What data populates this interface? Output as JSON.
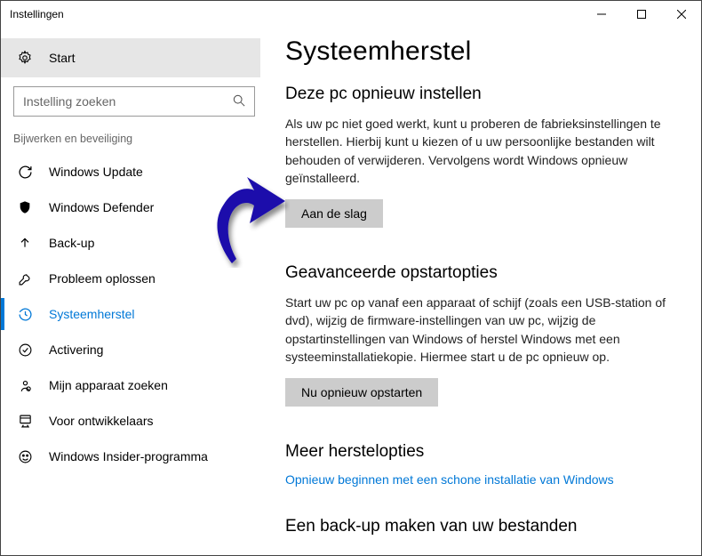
{
  "window": {
    "title": "Instellingen"
  },
  "sidebar": {
    "start_label": "Start",
    "search_placeholder": "Instelling zoeken",
    "section_label": "Bijwerken en beveiliging",
    "items": [
      {
        "label": "Windows Update",
        "icon": "sync-icon"
      },
      {
        "label": "Windows Defender",
        "icon": "shield-icon"
      },
      {
        "label": "Back-up",
        "icon": "backup-arrow-icon"
      },
      {
        "label": "Probleem oplossen",
        "icon": "wrench-icon"
      },
      {
        "label": "Systeemherstel",
        "icon": "history-icon",
        "active": true
      },
      {
        "label": "Activering",
        "icon": "check-circle-icon"
      },
      {
        "label": "Mijn apparaat zoeken",
        "icon": "find-device-icon"
      },
      {
        "label": "Voor ontwikkelaars",
        "icon": "developer-icon"
      },
      {
        "label": "Windows Insider-programma",
        "icon": "insider-icon"
      }
    ]
  },
  "main": {
    "title": "Systeemherstel",
    "reset": {
      "heading": "Deze pc opnieuw instellen",
      "text": "Als uw pc niet goed werkt, kunt u proberen de fabrieksinstellingen te herstellen. Hierbij kunt u kiezen of u uw persoonlijke bestanden wilt behouden of verwijderen. Vervolgens wordt Windows opnieuw geïnstalleerd.",
      "button": "Aan de slag"
    },
    "advanced": {
      "heading": "Geavanceerde opstartopties",
      "text": "Start uw pc op vanaf een apparaat of schijf (zoals een USB-station of dvd), wijzig de firmware-instellingen van uw pc, wijzig de opstartinstellingen van Windows of herstel Windows met een systeeminstallatiekopie. Hiermee start u de pc opnieuw op.",
      "button": "Nu opnieuw opstarten"
    },
    "more": {
      "heading": "Meer herstelopties",
      "link": "Opnieuw beginnen met een schone installatie van Windows"
    },
    "backup": {
      "heading": "Een back-up maken van uw bestanden"
    }
  },
  "annotation": {
    "arrow_color": "#1a0dab"
  }
}
